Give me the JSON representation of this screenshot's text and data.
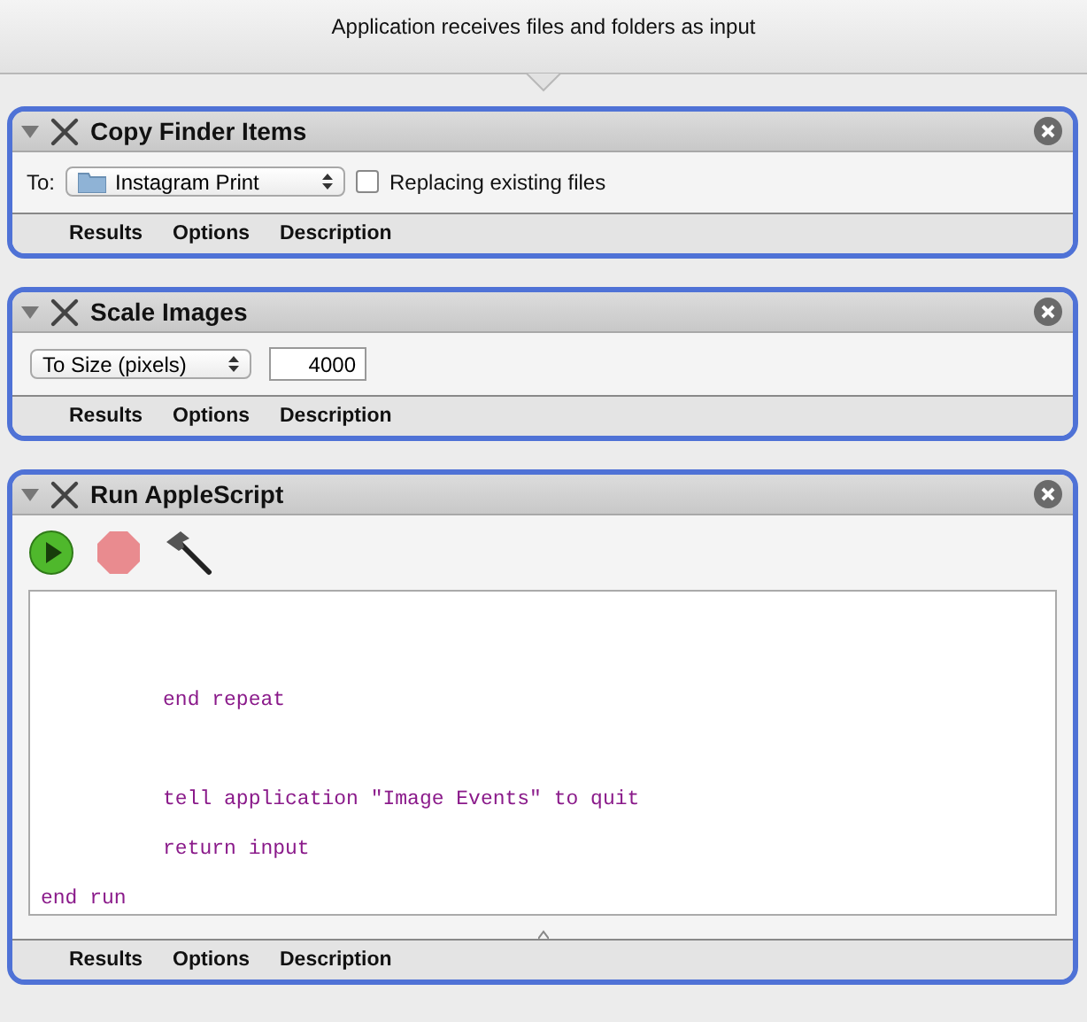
{
  "header": {
    "text": "Application receives files and folders as input"
  },
  "actions": [
    {
      "kind": "copy",
      "title": "Copy Finder Items",
      "expanded": true,
      "to_label": "To:",
      "folder": "Instagram Print",
      "checkbox": {
        "label": "Replacing existing files",
        "checked": false
      },
      "tabs": [
        "Results",
        "Options",
        "Description"
      ]
    },
    {
      "kind": "scale",
      "title": "Scale Images",
      "expanded": true,
      "mode": "To Size (pixels)",
      "value": "4000",
      "tabs": [
        "Results",
        "Options",
        "Description"
      ]
    },
    {
      "kind": "script",
      "title": "Run AppleScript",
      "expanded": true,
      "lines": [
        {
          "kind": "blank"
        },
        {
          "kind": "code",
          "text": "\t\tend repeat"
        },
        {
          "kind": "blank"
        },
        {
          "kind": "code",
          "text": "\t\ttell application \"Image Events\" to quit"
        },
        {
          "kind": "code",
          "text": "\t\treturn input"
        },
        {
          "kind": "code",
          "text": "end run"
        }
      ],
      "tabs": [
        "Results",
        "Options",
        "Description"
      ]
    }
  ]
}
